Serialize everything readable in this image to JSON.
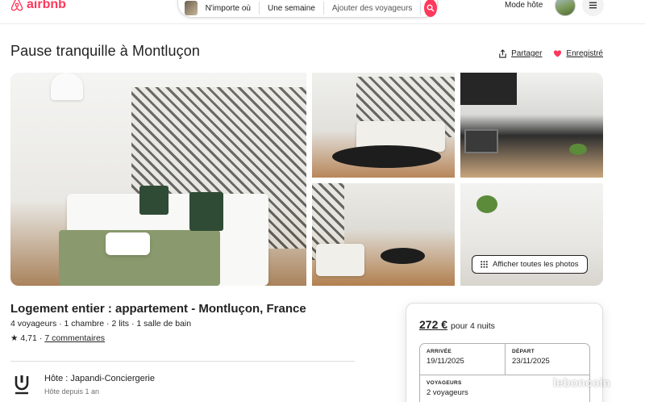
{
  "header": {
    "brand": "airbnb",
    "search": {
      "where": "N'importe où",
      "when": "Une semaine",
      "who": "Ajouter des voyageurs"
    },
    "host_mode": "Mode hôte"
  },
  "listing": {
    "title": "Pause tranquille à Montluçon",
    "share_label": "Partager",
    "save_label": "Enregistré",
    "show_all_photos": "Afficher toutes les photos",
    "subtitle": "Logement entier : appartement - Montluçon, France",
    "details": "4 voyageurs · 1 chambre · 2 lits · 1 salle de bain",
    "rating_star": "★",
    "rating": "4,71",
    "rating_sep": "·",
    "reviews": "7 commentaires",
    "host_name": "Hôte : Japandi-Conciergerie",
    "host_since": "Hôte depuis 1 an"
  },
  "booking": {
    "price": "272 €",
    "price_suffix": "pour 4 nuits",
    "checkin_label": "ARRIVÉE",
    "checkin_value": "19/11/2025",
    "checkout_label": "DÉPART",
    "checkout_value": "23/11/2025",
    "guests_label": "VOYAGEURS",
    "guests_value": "2 voyageurs"
  },
  "watermark": "leboncoin",
  "colors": {
    "brand": "#ff385c",
    "text": "#222222",
    "muted": "#717171"
  },
  "icons": [
    "airbnb-logo-icon",
    "search-icon",
    "menu-icon",
    "share-icon",
    "heart-icon",
    "grid-icon",
    "host-logo-icon"
  ]
}
